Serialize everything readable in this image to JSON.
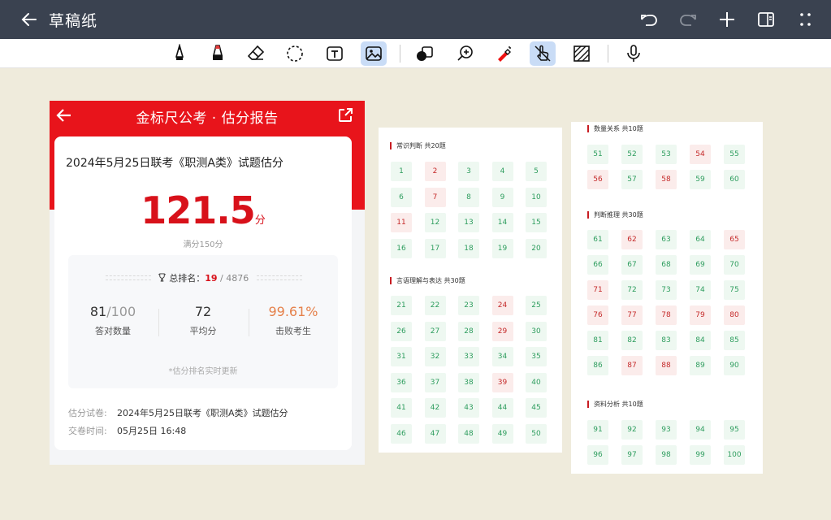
{
  "app": {
    "title": "草稿纸",
    "icons": [
      "back-arrow-icon",
      "undo-icon",
      "redo-icon",
      "plus-icon",
      "side-panel-icon",
      "more-dots-icon"
    ]
  },
  "toolbar": {
    "tools": [
      {
        "name": "pen-tool",
        "icon": "pen-icon",
        "active": false
      },
      {
        "name": "marker-tool",
        "icon": "highlighter-icon",
        "active": false
      },
      {
        "name": "eraser-tool",
        "icon": "eraser-icon",
        "active": false
      },
      {
        "name": "lasso-tool",
        "icon": "lasso-icon",
        "active": false
      },
      {
        "name": "text-tool",
        "icon": "text-box-icon",
        "active": false
      },
      {
        "name": "image-tool",
        "icon": "image-icon",
        "active": true
      },
      {
        "name": "shape-tool",
        "icon": "shapes-icon",
        "active": false
      },
      {
        "name": "zoom-tool",
        "icon": "zoom-in-icon",
        "active": false
      },
      {
        "name": "laser-tool",
        "icon": "laser-pointer-icon",
        "active": false
      },
      {
        "name": "touch-tool",
        "icon": "hand-touch-icon",
        "active": true
      },
      {
        "name": "background-tool",
        "icon": "hatch-pattern-icon",
        "active": false
      },
      {
        "name": "mic-tool",
        "icon": "microphone-icon",
        "active": false
      }
    ]
  },
  "report": {
    "header_title": "金标尺公考 · 估分报告",
    "exam_title": "2024年5月25日联考《职测A类》试题估分",
    "score": "121.5",
    "score_unit": "分",
    "full_marks": "满分150分",
    "rank_label": "总排名：",
    "rank_value": "19",
    "rank_total": "/ 4876",
    "stats": [
      {
        "value": "81",
        "sub": "/100",
        "label": "答对数量",
        "color": "#333333"
      },
      {
        "value": "72",
        "sub": "",
        "label": "平均分",
        "color": "#333333"
      },
      {
        "value": "99.61%",
        "sub": "",
        "label": "击败考生",
        "color": "#e5804a"
      }
    ],
    "note": "*估分排名实时更新",
    "meta": [
      {
        "key": "估分试卷:",
        "value": "2024年5月25日联考《职测A类》试题估分"
      },
      {
        "key": "交卷时间:",
        "value": "05月25日 16:48"
      }
    ]
  },
  "answer_sheets": {
    "sections": [
      {
        "title": "常识判断 共20题",
        "start": 1,
        "end": 20,
        "wrong": [
          2,
          7,
          11
        ]
      },
      {
        "title": "言语理解与表达 共30题",
        "start": 21,
        "end": 50,
        "wrong": [
          24,
          29,
          39
        ]
      },
      {
        "title": "数量关系 共10题",
        "start": 51,
        "end": 60,
        "wrong": [
          54,
          56,
          58
        ]
      },
      {
        "title": "判断推理 共30题",
        "start": 61,
        "end": 90,
        "wrong": [
          62,
          65,
          71,
          76,
          77,
          78,
          79,
          80,
          87,
          88
        ]
      },
      {
        "title": "资料分析 共10题",
        "start": 91,
        "end": 100,
        "wrong": []
      }
    ]
  },
  "colors": {
    "appbar": "#3a4250",
    "brand_red": "#e8141b",
    "correct_green": "#2e9d5e",
    "wrong_red": "#c52a2a",
    "canvas": "#efebdc"
  }
}
